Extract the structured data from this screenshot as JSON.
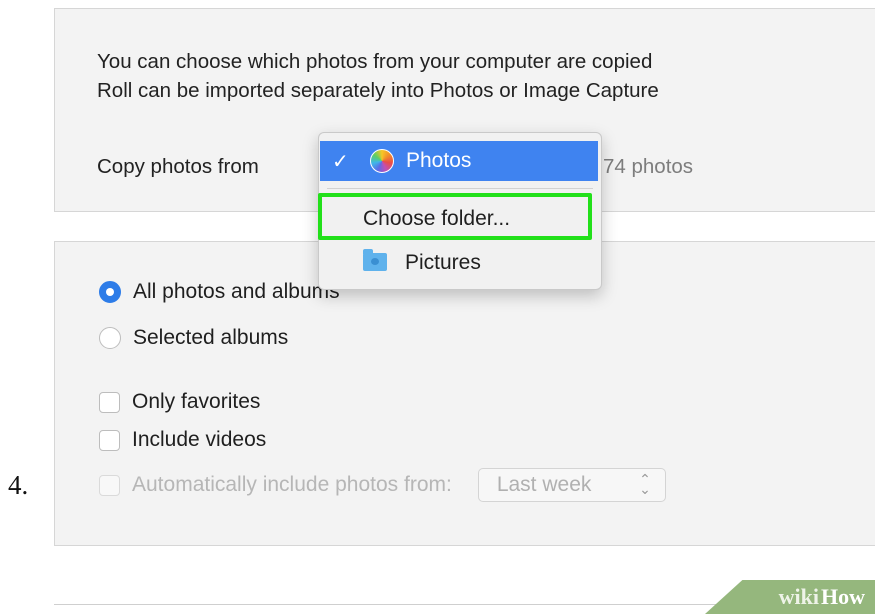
{
  "step_number": "4.",
  "description": {
    "line1": "You can choose which photos from your computer are copied",
    "line2": "Roll can be imported separately into Photos or Image Capture"
  },
  "copy_from": {
    "label": "Copy photos from",
    "count": "74 photos"
  },
  "menu": {
    "selected_check": "✓",
    "selected_label": "Photos",
    "choose_folder": "Choose folder...",
    "pictures": "Pictures",
    "highlight_color": "#22e01a"
  },
  "options": {
    "all_photos": "All photos and albums",
    "selected_albums": "Selected albums",
    "only_favorites": "Only favorites",
    "include_videos": "Include videos",
    "auto_include": "Automatically include photos from:",
    "auto_include_value": "Last week"
  },
  "watermark": {
    "wiki": "wiki",
    "how": "How"
  }
}
